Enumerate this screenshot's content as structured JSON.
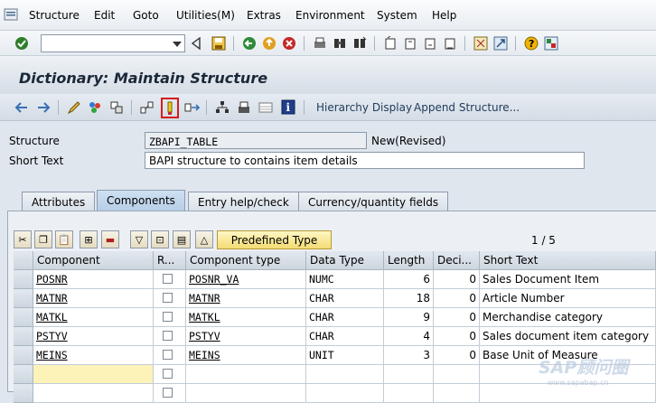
{
  "menu": [
    "Structure",
    "Edit",
    "Goto",
    "Utilities(M)",
    "Extras",
    "Environment",
    "System",
    "Help"
  ],
  "title": "Dictionary: Maintain Structure",
  "toolbar2": {
    "hierarchy_label": "Hierarchy Display",
    "append_label": "Append Structure..."
  },
  "form": {
    "structure_label": "Structure",
    "structure_value": "ZBAPI_TABLE",
    "structure_status": "New(Revised)",
    "short_text_label": "Short Text",
    "short_text_value": "BAPI structure to contains item details"
  },
  "tabs": [
    "Attributes",
    "Components",
    "Entry help/check",
    "Currency/quantity fields"
  ],
  "predefined_type_label": "Predefined Type",
  "pager": "1  /  5",
  "columns": [
    "Component",
    "R...",
    "Component type",
    "Data Type",
    "Length",
    "Deci...",
    "Short Text"
  ],
  "rows": [
    {
      "component": "POSNR",
      "ctype": "POSNR_VA",
      "dtype": "NUMC",
      "length": "6",
      "deci": "0",
      "text": "Sales Document Item"
    },
    {
      "component": "MATNR",
      "ctype": "MATNR",
      "dtype": "CHAR",
      "length": "18",
      "deci": "0",
      "text": "Article Number"
    },
    {
      "component": "MATKL",
      "ctype": "MATKL",
      "dtype": "CHAR",
      "length": "9",
      "deci": "0",
      "text": "Merchandise category"
    },
    {
      "component": "PSTYV",
      "ctype": "PSTYV",
      "dtype": "CHAR",
      "length": "4",
      "deci": "0",
      "text": "Sales document item category"
    },
    {
      "component": "MEINS",
      "ctype": "MEINS",
      "dtype": "UNIT",
      "length": "3",
      "deci": "0",
      "text": "Base Unit of Measure"
    }
  ],
  "watermark": {
    "main": "SAP顾问圈",
    "sub": "www.sapabap.cn"
  }
}
